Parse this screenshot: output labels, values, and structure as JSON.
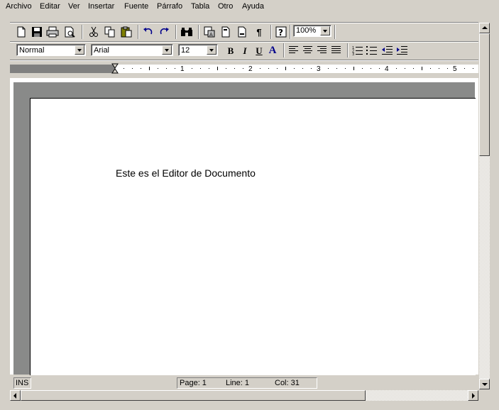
{
  "menu": [
    "Archivo",
    "Editar",
    "Ver",
    "Insertar",
    "Fuente",
    "Párrafo",
    "Tabla",
    "Otro",
    "Ayuda"
  ],
  "toolbar": {
    "zoom": "100%",
    "style": "Normal",
    "font": "Arial",
    "size": "12",
    "bold_label": "B",
    "italic_label": "I",
    "underline_label": "U",
    "color_label": "A",
    "pilcrow_label": "¶",
    "help_label": "?"
  },
  "ruler": {
    "numbers": [
      "1",
      "2",
      "3",
      "4",
      "5"
    ]
  },
  "document": {
    "text": "Este es el Editor de Documento"
  },
  "status": {
    "mode": "INS",
    "page": "Page: 1",
    "line": "Line: 1",
    "col": "Col: 31"
  },
  "colors": {
    "chrome": "#d4d0c8",
    "page_shadow": "#898a89",
    "ruler_margin": "#808080",
    "text_color_icon": "#00008b"
  }
}
